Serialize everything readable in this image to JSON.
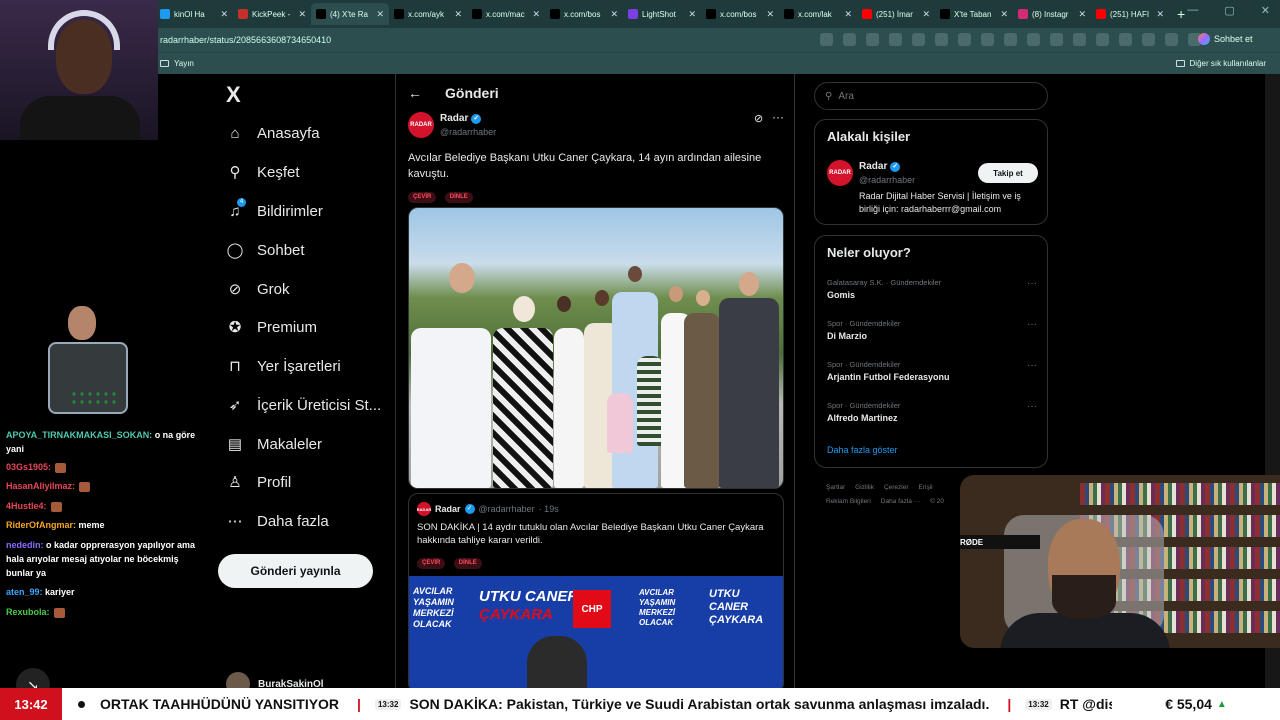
{
  "browser": {
    "tabs": [
      {
        "title": "kinOl Ha",
        "icon": "twitter-icon",
        "active": false
      },
      {
        "title": "KickPeek -",
        "icon": "kickpeek-icon",
        "active": false
      },
      {
        "title": "(4) X'te Ra",
        "icon": "x-icon",
        "active": true
      },
      {
        "title": "x.com/ayk",
        "icon": "x-icon",
        "active": false
      },
      {
        "title": "x.com/mac",
        "icon": "x-icon",
        "active": false
      },
      {
        "title": "x.com/bos",
        "icon": "x-icon",
        "active": false
      },
      {
        "title": "LightShot",
        "icon": "lightshot-icon",
        "active": false
      },
      {
        "title": "x.com/bos",
        "icon": "x-icon",
        "active": false
      },
      {
        "title": "x.com/lak",
        "icon": "x-icon",
        "active": false
      },
      {
        "title": "(251) İmar",
        "icon": "youtube-icon",
        "active": false
      },
      {
        "title": "X'te Taban",
        "icon": "x-icon",
        "active": false
      },
      {
        "title": "(8) Instagr",
        "icon": "instagram-icon",
        "active": false
      },
      {
        "title": "(251) HAFI",
        "icon": "youtube-icon",
        "active": false
      }
    ],
    "url": "radarrhaber/status/2085663608734650410",
    "sync_label": "Sohbet et",
    "bookmark_left": "Yayın",
    "bookmark_right": "Diğer sık kullanılanlar"
  },
  "nav": {
    "logo": "X",
    "items": [
      {
        "label": "Anasayfa",
        "icon": "home-icon",
        "glyph": "⌂"
      },
      {
        "label": "Keşfet",
        "icon": "search-icon",
        "glyph": "⚲"
      },
      {
        "label": "Bildirimler",
        "icon": "bell-icon",
        "glyph": "♫"
      },
      {
        "label": "Sohbet",
        "icon": "chat-icon",
        "glyph": "◯"
      },
      {
        "label": "Grok",
        "icon": "grok-icon",
        "glyph": "⊘"
      },
      {
        "label": "Premium",
        "icon": "premium-icon",
        "glyph": "✪"
      },
      {
        "label": "Yer İşaretleri",
        "icon": "bookmark-icon",
        "glyph": "⊓"
      },
      {
        "label": "İçerik Üreticisi St...",
        "icon": "rocket-icon",
        "glyph": "➶"
      },
      {
        "label": "Makaleler",
        "icon": "article-icon",
        "glyph": "▤"
      },
      {
        "label": "Profil",
        "icon": "profile-icon",
        "glyph": "♙"
      },
      {
        "label": "Daha fazla",
        "icon": "more-icon",
        "glyph": "⋯"
      }
    ],
    "notification_badge": "4",
    "post_button": "Gönderi yayınla",
    "account_name": "BurakSakinOl"
  },
  "main": {
    "title": "Gönderi",
    "tweet": {
      "avatar_text": "RADAR",
      "name": "Radar",
      "handle": "@radarrhaber",
      "text": "Avcılar Belediye Başkanı Utku Caner Çaykara, 14 ayın ardından ailesine kavuştu.",
      "tags": [
        "ÇEVİR",
        "DİNLE"
      ]
    },
    "quote": {
      "name": "Radar",
      "handle": "@radarrhaber",
      "time": "· 19s",
      "text": "SON DAKİKA | 14 aydır tutuklu olan Avcılar Belediye Başkanı Utku Caner Çaykara hakkında tahliye kararı verildi.",
      "tags": [
        "ÇEVİR",
        "DİNLE"
      ],
      "banner": {
        "left": "AVCILAR YAŞAMIN MERKEZİ OLACAK",
        "name1": "UTKU CANER",
        "name2": "ÇAYKARA",
        "party": "CHP",
        "right1": "AVCILAR YAŞAMIN MERKEZİ OLACAK",
        "right2": "UTKU CANER ÇAYKARA"
      }
    }
  },
  "right": {
    "search_placeholder": "Ara",
    "related": {
      "title": "Alakalı kişiler",
      "name": "Radar",
      "handle": "@radarrhaber",
      "follow": "Takip et",
      "bio": "Radar Dijital Haber Servisi | İletişim ve iş birliği için: radarhaberrr@gmail.com"
    },
    "trends": {
      "title": "Neler oluyor?",
      "items": [
        {
          "meta": "Galatasaray S.K. · Gündemdekiler",
          "name": "Gomis"
        },
        {
          "meta": "Spor · Gündemdekiler",
          "name": "Di Marzio"
        },
        {
          "meta": "Spor · Gündemdekiler",
          "name": "Arjantin Futbol Federasyonu"
        },
        {
          "meta": "Spor · Gündemdekiler",
          "name": "Alfredo Martinez"
        }
      ],
      "show_more": "Daha fazla göster"
    },
    "footer": [
      "Şartlar",
      "Gizlilik",
      "Çerezler",
      "Erişil",
      "Reklam Bilgileri",
      "Daha fazla ···",
      "© 20"
    ]
  },
  "chat": {
    "messages": [
      {
        "user": "APOYA_TIRNAKMAKASI_SOKAN:",
        "text": " o na göre yani",
        "color": "#4ec9b0"
      },
      {
        "user": "03Gs1905:",
        "text": "",
        "color": "#e8485a",
        "emote": true
      },
      {
        "user": "HasanAliyilmaz:",
        "text": "",
        "color": "#e8485a",
        "emote": true
      },
      {
        "user": "4Hustle4:",
        "text": "",
        "color": "#e8485a",
        "emote": true
      },
      {
        "user": "RiderOfAngmar:",
        "text": " meme",
        "color": "#f5a623"
      },
      {
        "user": "nededin:",
        "text": " o kadar opprerasyon yapılıyor ama hala arıyolar mesaj atıyolar ne böcekmiş bunlar ya",
        "color": "#8a6cff"
      },
      {
        "user": "aten_99:",
        "text": " kariyer",
        "color": "#3aa6ff"
      },
      {
        "user": "Rexubola:",
        "text": "",
        "color": "#4ec94e",
        "emote": true
      }
    ]
  },
  "stream": {
    "mic_label": "RØDE"
  },
  "ticker": {
    "time": "13:42",
    "items": [
      {
        "badge": "",
        "text": "ORTAK TAAHHÜDÜNÜ YANSITIYOR"
      },
      {
        "badge": "13:32",
        "text": "SON DAKİKA: Pakistan, Türkiye ve Suudi Arabistan ortak savunma anlaşması imzaladı."
      },
      {
        "badge": "13:32",
        "text": "RT @discl"
      }
    ],
    "price": "€ 55,04"
  }
}
